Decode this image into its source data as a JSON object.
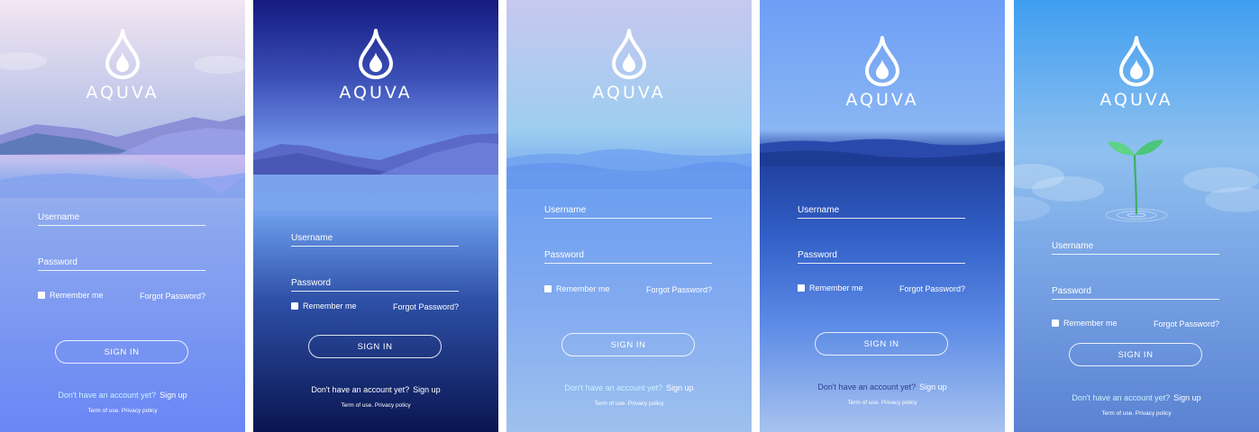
{
  "app": {
    "brand": "AQUVA"
  },
  "form": {
    "username_placeholder": "Username",
    "password_placeholder": "Password",
    "remember_label": "Remember me",
    "forgot_label": "Forgot Password?",
    "signin_label": "SIGN IN",
    "signup_question": "Don't have an account yet?",
    "signup_link": "Sign up",
    "terms_label": "Term of use.",
    "privacy_label": "Privacy policy"
  },
  "icons": {
    "logo": "water-drop-icon",
    "plant": "sprout-icon"
  },
  "colors": {
    "v1_top": "#f4e6f2",
    "v1_bottom": "#6a86f5",
    "v2_top": "#141a80",
    "v2_bottom": "#0a1550",
    "v3_top": "#c7c8ef",
    "v3_bottom": "#9ec1ee",
    "v4_top": "#6d9ef5",
    "v4_bottom": "#a7c2ef",
    "v5_top": "#3f9ef0",
    "v5_bottom": "#5a82d2"
  }
}
